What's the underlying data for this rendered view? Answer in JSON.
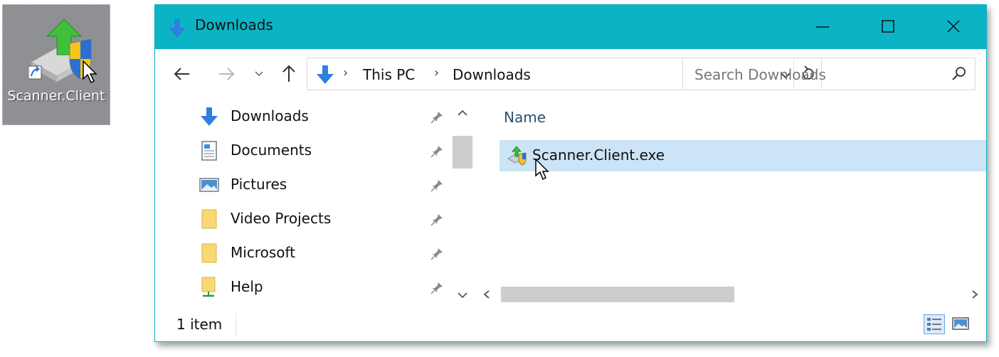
{
  "desktop": {
    "shortcut_label": "Scanner.Client"
  },
  "window": {
    "title": "Downloads",
    "accent": "#0ab4c4"
  },
  "address": {
    "crumbs": [
      "This PC",
      "Downloads"
    ]
  },
  "search": {
    "placeholder": "Search Downloads"
  },
  "nav": {
    "items": [
      {
        "label": "Downloads",
        "icon": "downloads-icon"
      },
      {
        "label": "Documents",
        "icon": "documents-icon"
      },
      {
        "label": "Pictures",
        "icon": "pictures-icon"
      },
      {
        "label": "Video Projects",
        "icon": "folder-icon"
      },
      {
        "label": "Microsoft",
        "icon": "folder-icon"
      },
      {
        "label": "Help",
        "icon": "network-folder-icon"
      }
    ]
  },
  "content": {
    "column_header": "Name",
    "files": [
      {
        "name": "Scanner.Client.exe"
      }
    ]
  },
  "status": {
    "item_count": "1 item"
  }
}
